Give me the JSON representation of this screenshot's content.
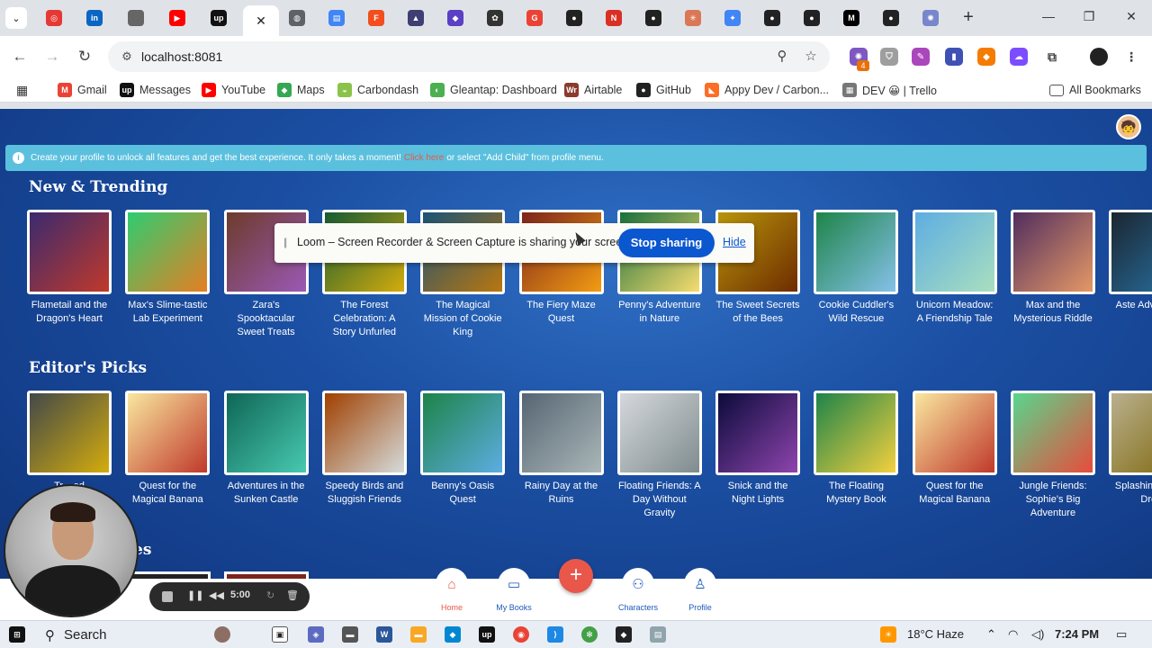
{
  "browser": {
    "tabs": [
      {
        "name": "tab-target",
        "icon": "target-icon",
        "color": "#e53935",
        "glyph": "◎"
      },
      {
        "name": "tab-linkedin",
        "icon": "linkedin-icon",
        "color": "#0a66c2",
        "glyph": "in"
      },
      {
        "name": "tab-apple",
        "icon": "apple-icon",
        "color": "#666666",
        "glyph": ""
      },
      {
        "name": "tab-youtube",
        "icon": "youtube-icon",
        "color": "#ff0000",
        "glyph": "▶"
      },
      {
        "name": "tab-upwork",
        "icon": "upwork-icon",
        "color": "#111111",
        "glyph": "up"
      },
      {
        "name": "tab-globe",
        "icon": "globe-icon",
        "color": "#5f6368",
        "glyph": "◍"
      },
      {
        "name": "tab-docs",
        "icon": "docs-icon",
        "color": "#4285f4",
        "glyph": "▤"
      },
      {
        "name": "tab-figma",
        "icon": "figma-icon",
        "color": "#f24e1e",
        "glyph": "F"
      },
      {
        "name": "tab-cap",
        "icon": "graduation-cap-icon",
        "color": "#3f3f73",
        "glyph": "▲"
      },
      {
        "name": "tab-stack",
        "icon": "stack-icon",
        "color": "#5b3fc4",
        "glyph": "◆"
      },
      {
        "name": "tab-openai",
        "icon": "openai-icon",
        "color": "#333333",
        "glyph": "✿"
      },
      {
        "name": "tab-google",
        "icon": "google-icon",
        "color": "#ea4335",
        "glyph": "G"
      },
      {
        "name": "tab-github-1",
        "icon": "github-icon",
        "color": "#222222",
        "glyph": "●"
      },
      {
        "name": "tab-red",
        "icon": "red-square-icon",
        "color": "#d93025",
        "glyph": "N"
      },
      {
        "name": "tab-github-2",
        "icon": "github-icon",
        "color": "#222222",
        "glyph": "●"
      },
      {
        "name": "tab-claude",
        "icon": "asterisk-icon",
        "color": "#d97757",
        "glyph": "✳"
      },
      {
        "name": "tab-gemini",
        "icon": "sparkle-icon",
        "color": "#4285f4",
        "glyph": "✦"
      },
      {
        "name": "tab-github-3",
        "icon": "github-icon",
        "color": "#222222",
        "glyph": "●"
      },
      {
        "name": "tab-github-4",
        "icon": "github-icon",
        "color": "#222222",
        "glyph": "●"
      },
      {
        "name": "tab-medium",
        "icon": "medium-icon",
        "color": "#000000",
        "glyph": "M"
      },
      {
        "name": "tab-github-5",
        "icon": "github-icon",
        "color": "#222222",
        "glyph": "●"
      },
      {
        "name": "tab-settings",
        "icon": "gear-icon",
        "color": "#7986cb",
        "glyph": "✺"
      }
    ],
    "url": "localhost:8081"
  },
  "bookmarks": [
    {
      "label": "Gmail",
      "icon": "gmail-icon",
      "color": "#ea4335",
      "glyph": "M"
    },
    {
      "label": "Messages",
      "icon": "upwork-icon",
      "color": "#111111",
      "glyph": "up"
    },
    {
      "label": "YouTube",
      "icon": "youtube-icon",
      "color": "#ff0000",
      "glyph": "▶"
    },
    {
      "label": "Maps",
      "icon": "maps-icon",
      "color": "#34a853",
      "glyph": "◆"
    },
    {
      "label": "Carbondash",
      "icon": "carbondash-icon",
      "color": "#8bc34a",
      "glyph": "◒"
    },
    {
      "label": "Gleantap: Dashboard",
      "icon": "gleantap-icon",
      "color": "#4caf50",
      "glyph": "◐"
    },
    {
      "label": "Airtable",
      "icon": "airtable-icon",
      "color": "#8b3a2b",
      "glyph": "Wr"
    },
    {
      "label": "GitHub",
      "icon": "github-icon",
      "color": "#222222",
      "glyph": "●"
    },
    {
      "label": "Appy Dev / Carbon...",
      "icon": "gitlab-icon",
      "color": "#fc6d26",
      "glyph": "◣"
    },
    {
      "label": "DEV 😀 | Trello",
      "icon": "trello-icon",
      "color": "#777777",
      "glyph": "▦"
    }
  ],
  "all_bookmarks": "All Bookmarks",
  "banner": {
    "text_before": "Create your profile to unlock all features and get the best experience. It only takes a moment!",
    "link": "Click here",
    "text_after": "or select \"Add Child\" from profile menu."
  },
  "sections": {
    "trending_title": "New & Trending",
    "picks_title": "Editor's Picks",
    "third_title": "es"
  },
  "trending": [
    {
      "title": "Flametail and the Dragon's Heart",
      "colors": [
        "#3a2a6e",
        "#c0392b"
      ]
    },
    {
      "title": "Max's Slime-tastic Lab Experiment",
      "colors": [
        "#2ecc71",
        "#e67e22"
      ]
    },
    {
      "title": "Zara's Spooktacular Sweet Treats",
      "colors": [
        "#6d3b2b",
        "#9b59b6"
      ]
    },
    {
      "title": "The Forest Celebration: A Story Unfurled",
      "colors": [
        "#145a32",
        "#d4ac0d"
      ]
    },
    {
      "title": "The Magical Mission of Cookie King",
      "colors": [
        "#1a5276",
        "#b9770e"
      ]
    },
    {
      "title": "The Fiery Maze Quest",
      "colors": [
        "#7b241c",
        "#f39c12"
      ]
    },
    {
      "title": "Penny's Adventure in Nature",
      "colors": [
        "#196f3d",
        "#f7dc6f"
      ]
    },
    {
      "title": "The Sweet Secrets of the Bees",
      "colors": [
        "#b7950b",
        "#6e2c00"
      ]
    },
    {
      "title": "Cookie Cuddler's Wild Rescue",
      "colors": [
        "#1e8449",
        "#85c1e9"
      ]
    },
    {
      "title": "Unicorn Meadow: A Friendship Tale",
      "colors": [
        "#5dade2",
        "#a9dfbf"
      ]
    },
    {
      "title": "Max and the Mysterious Riddle",
      "colors": [
        "#512e5f",
        "#e59866"
      ]
    },
    {
      "title": "Aste Adventu Ta",
      "colors": [
        "#1b2631",
        "#2874a6"
      ]
    }
  ],
  "picks": [
    {
      "title": "Tr... ed",
      "colors": [
        "#424949",
        "#d4ac0d"
      ]
    },
    {
      "title": "Quest for the Magical Banana",
      "colors": [
        "#f9e79f",
        "#c0392b"
      ]
    },
    {
      "title": "Adventures in the Sunken Castle",
      "colors": [
        "#0e6655",
        "#48c9b0"
      ]
    },
    {
      "title": "Speedy Birds and Sluggish Friends",
      "colors": [
        "#a04000",
        "#d5dbdb"
      ]
    },
    {
      "title": "Benny's Oasis Quest",
      "colors": [
        "#1d8348",
        "#5dade2"
      ]
    },
    {
      "title": "Rainy Day at the Ruins",
      "colors": [
        "#566573",
        "#aab7b8"
      ]
    },
    {
      "title": "Floating Friends: A Day Without Gravity",
      "colors": [
        "#d5d8dc",
        "#7f8c8d"
      ]
    },
    {
      "title": "Snick and the Night Lights",
      "colors": [
        "#0b0b3b",
        "#8e44ad"
      ]
    },
    {
      "title": "The Floating Mystery Book",
      "colors": [
        "#1e8449",
        "#f4d03f"
      ]
    },
    {
      "title": "Quest for the Magical Banana",
      "colors": [
        "#f9e79f",
        "#c0392b"
      ]
    },
    {
      "title": "Jungle Friends: Sophie's Big Adventure",
      "colors": [
        "#58d68d",
        "#e74c3c"
      ]
    },
    {
      "title": "Splashin and Ho Drea",
      "colors": [
        "#b9b08f",
        "#7d6608"
      ]
    }
  ],
  "loom": {
    "message": "Loom – Screen Recorder & Screen Capture is sharing your screen.",
    "stop": "Stop sharing",
    "hide": "Hide",
    "timer": "5:00"
  },
  "bottom_nav": {
    "home": "Home",
    "my_books": "My Books",
    "characters": "Characters",
    "profile": "Profile",
    "add": "+"
  },
  "taskbar": {
    "search": "Search",
    "weather": "18°C  Haze",
    "time": "7:24 PM"
  }
}
